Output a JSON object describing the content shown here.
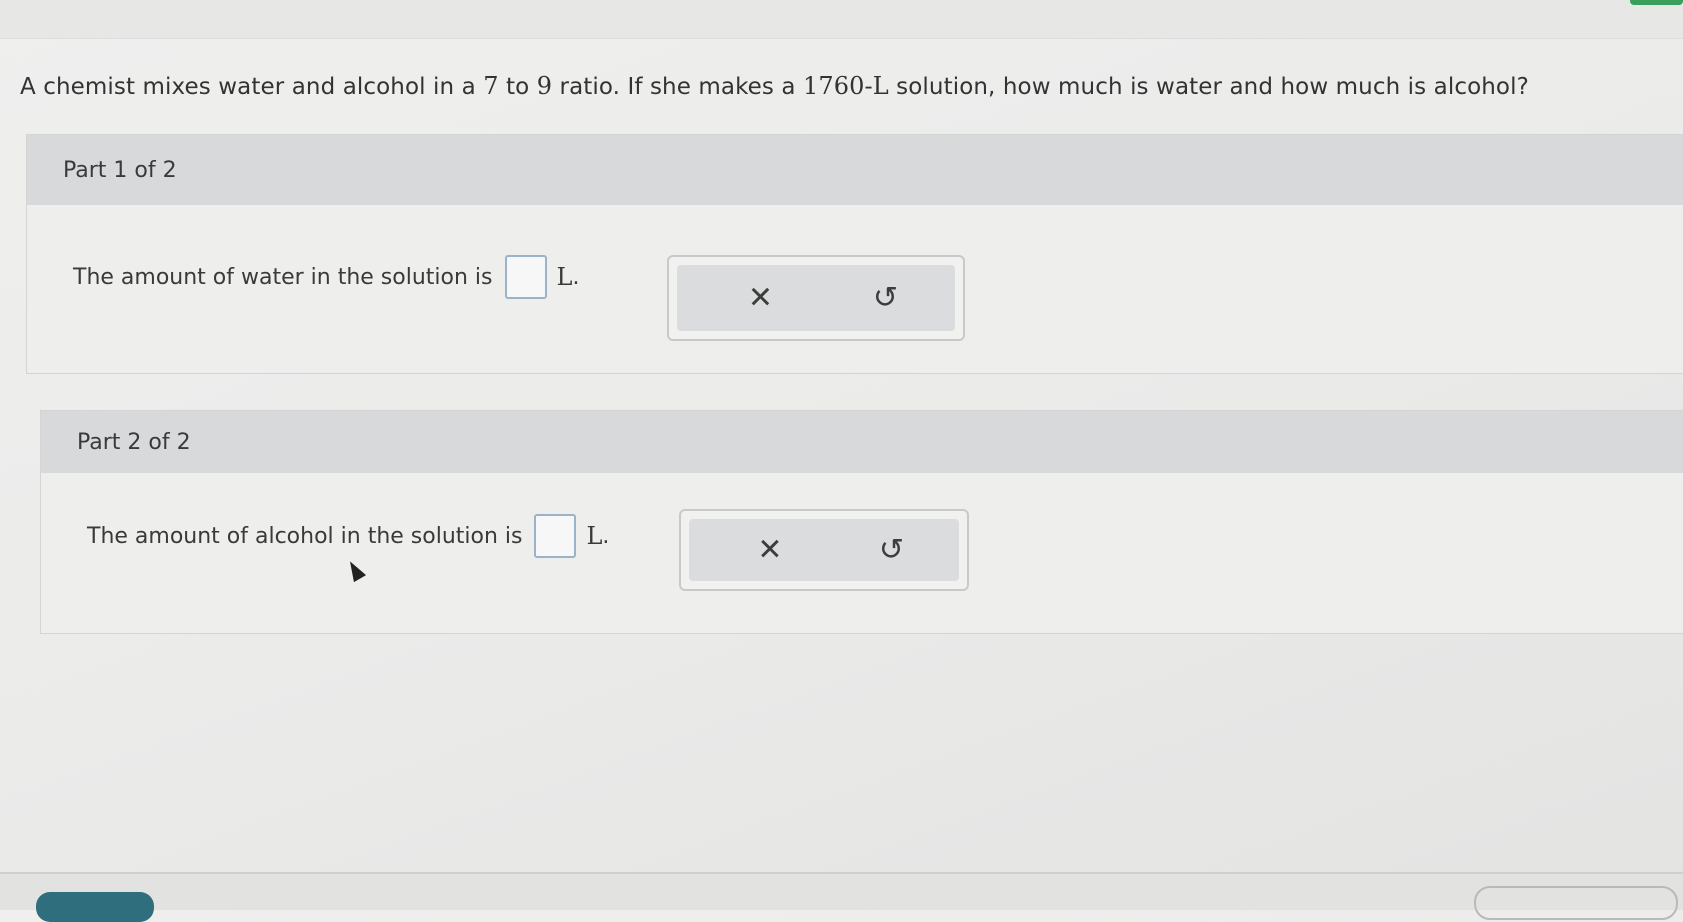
{
  "question": {
    "text_1": "A chemist mixes water and alcohol in a ",
    "ratio_a": "7",
    "text_2": " to ",
    "ratio_b": "9",
    "text_3": " ratio. If she makes a ",
    "volume": "1760-L",
    "text_4": " solution, how much is water and how much is alcohol?"
  },
  "parts": [
    {
      "header": "Part 1 of 2",
      "prompt": "The amount of water in the solution is",
      "answer_value": "",
      "unit": "L",
      "period": "."
    },
    {
      "header": "Part 2 of 2",
      "prompt": "The amount of alcohol in the solution is",
      "answer_value": "",
      "unit": "L",
      "period": "."
    }
  ],
  "tools": {
    "clear_icon": "close-icon",
    "clear_glyph": "✕",
    "undo_icon": "undo-icon",
    "undo_glyph": "↺"
  },
  "colors": {
    "header_bg": "#d8d9da",
    "answer_border": "#9ab3c8",
    "primary_button": "#2f6f7d"
  }
}
